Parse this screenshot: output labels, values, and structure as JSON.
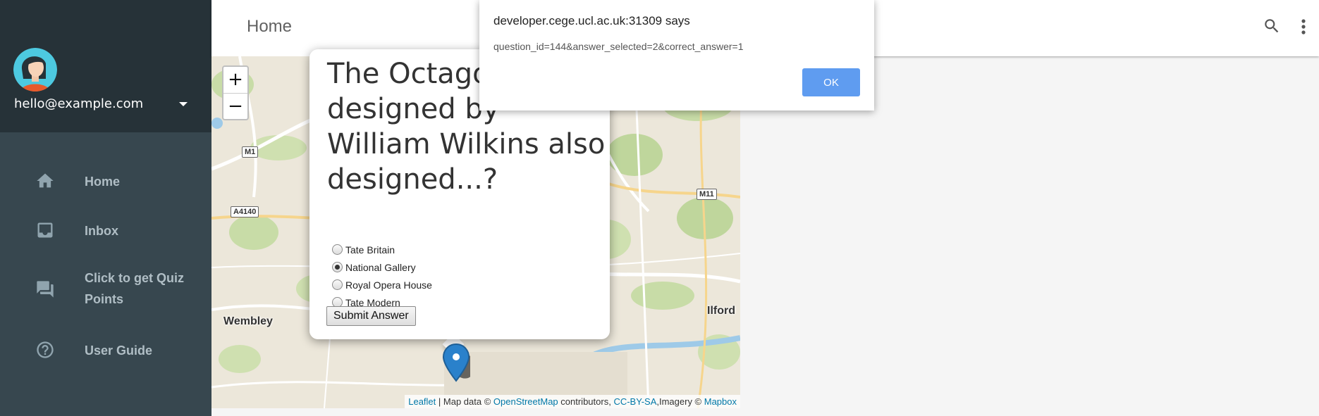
{
  "sidebar": {
    "user_email": "hello@example.com",
    "items": [
      {
        "label": "Home",
        "icon": "home-icon"
      },
      {
        "label": "Inbox",
        "icon": "inbox-icon"
      },
      {
        "label": "Click to get Quiz Points",
        "icon": "chat-icon"
      },
      {
        "label": "User Guide",
        "icon": "help-circle-icon"
      }
    ]
  },
  "topbar": {
    "title": "Home",
    "icons": [
      "search-icon",
      "more-vert-icon"
    ]
  },
  "map": {
    "zoom_in": "+",
    "zoom_out": "−",
    "places": {
      "wembley": "Wembley",
      "ilford": "Ilford"
    },
    "roads": {
      "m1": "M1",
      "a4140": "A4140",
      "m11": "M11"
    },
    "attribution": {
      "leaflet": "Leaflet",
      "sep1": " | Map data © ",
      "osm": "OpenStreetMap",
      "sep2": " contributors, ",
      "license": "CC-BY-SA",
      "sep3": ",Imagery © ",
      "mapbox": "Mapbox"
    }
  },
  "quiz": {
    "question": "The Octagon designed by William Wilkins also designed...?",
    "options": [
      "Tate Britain",
      "National Gallery",
      "Royal Opera House",
      "Tate Modern"
    ],
    "selected_index": 1,
    "submit_label": "Submit Answer"
  },
  "dialog": {
    "title": "developer.cege.ucl.ac.uk:31309 says",
    "message": "question_id=144&answer_selected=2&correct_answer=1",
    "ok_label": "OK"
  },
  "colors": {
    "sidebar_bg": "#37474f",
    "sidebar_header_bg": "#263238",
    "link": "#0078a8",
    "ok_button": "#5f9cf0",
    "marker": "#2a81cb"
  }
}
